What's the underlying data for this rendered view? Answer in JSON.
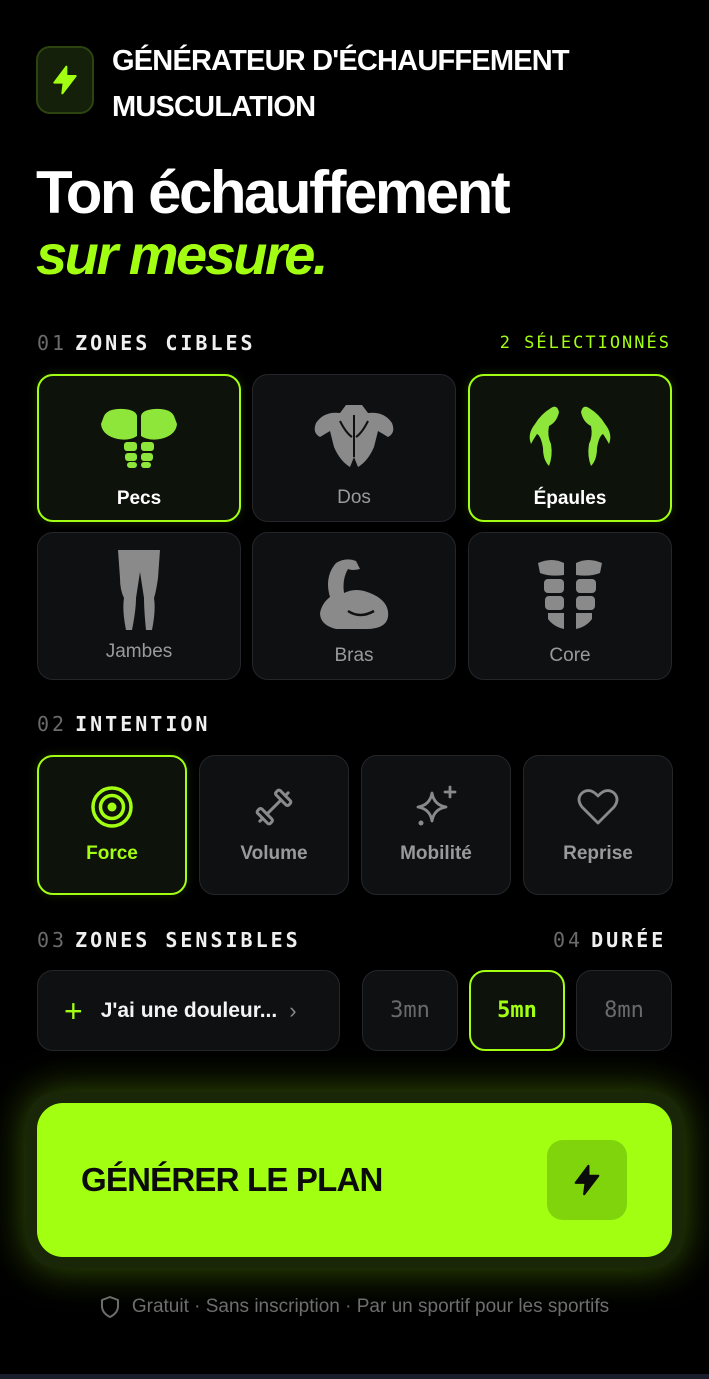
{
  "header": {
    "title": "GÉNÉRATEUR D'ÉCHAUFFEMENT MUSCULATION",
    "logo_icon": "bolt-icon"
  },
  "hero": {
    "line1": "Ton échauffement",
    "line2": "sur mesure."
  },
  "zones": {
    "num": "01",
    "label": "ZONES CIBLES",
    "count": "2 SÉLECTIONNÉS",
    "items": [
      {
        "label": "Pecs",
        "selected": true,
        "icon": "chest-muscle-icon"
      },
      {
        "label": "Dos",
        "selected": false,
        "icon": "back-muscle-icon"
      },
      {
        "label": "Épaules",
        "selected": true,
        "icon": "shoulder-muscle-icon"
      },
      {
        "label": "Jambes",
        "selected": false,
        "icon": "legs-muscle-icon"
      },
      {
        "label": "Bras",
        "selected": false,
        "icon": "bicep-icon"
      },
      {
        "label": "Core",
        "selected": false,
        "icon": "abs-icon"
      }
    ]
  },
  "intention": {
    "num": "02",
    "label": "INTENTION",
    "items": [
      {
        "label": "Force",
        "selected": true,
        "icon": "target-icon"
      },
      {
        "label": "Volume",
        "selected": false,
        "icon": "dumbbell-icon"
      },
      {
        "label": "Mobilité",
        "selected": false,
        "icon": "sparkle-icon"
      },
      {
        "label": "Reprise",
        "selected": false,
        "icon": "heart-icon"
      }
    ]
  },
  "sensitive": {
    "num": "03",
    "label": "ZONES SENSIBLES",
    "button_label": "J'ai une douleur..."
  },
  "duration": {
    "num": "04",
    "label": "DURÉE",
    "options": [
      {
        "label": "3mn",
        "selected": false
      },
      {
        "label": "5mn",
        "selected": true
      },
      {
        "label": "8mn",
        "selected": false
      }
    ]
  },
  "generate": {
    "label": "GÉNÉRER LE PLAN"
  },
  "footer": {
    "text": "Gratuit · Sans inscription · Par un sportif pour les sportifs"
  },
  "colors": {
    "accent": "#a3ff12",
    "background": "#000000",
    "card": "#0f1012"
  }
}
